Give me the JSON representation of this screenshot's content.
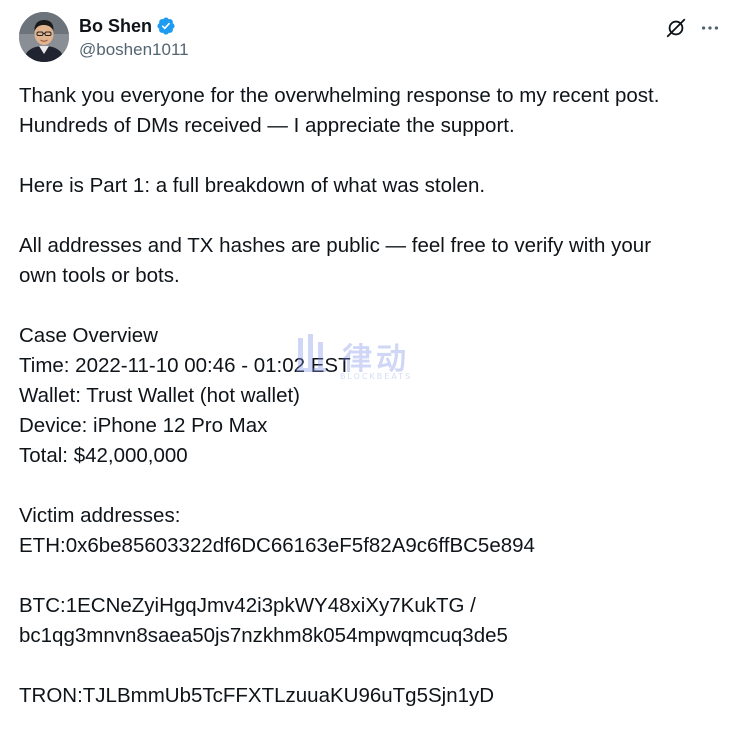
{
  "author": {
    "display_name": "Bo Shen",
    "handle": "@boshen1011",
    "verified": true,
    "verified_color": "#1d9bf0"
  },
  "icons": {
    "verified": "verified-badge-icon",
    "grok": "grok-icon",
    "more": "more-icon"
  },
  "tweet": {
    "paragraphs": [
      {
        "lines": [
          "Thank you everyone for the overwhelming response to my recent post.",
          "Hundreds of DMs received — I appreciate the support."
        ]
      },
      {
        "lines": [
          "Here is Part 1: a full breakdown of what was stolen."
        ]
      },
      {
        "lines": [
          "All addresses and TX hashes are public — feel free to verify with your",
          "own tools or bots."
        ]
      },
      {
        "lines": [
          "Case Overview",
          "Time: 2022-11-10 00:46 - 01:02 EST",
          "Wallet: Trust Wallet (hot wallet)",
          "Device: iPhone 12 Pro Max",
          "Total: $42,000,000"
        ]
      },
      {
        "lines": [
          "Victim addresses:",
          "ETH:0x6be85603322df6DC66163eF5f82A9c6ffBC5e894"
        ]
      },
      {
        "lines": [
          "BTC:1ECNeZyiHgqJmv42i3pkWY48xiXy7KukTG /",
          "bc1qg3mnvn8saea50js7nzkhm8k054mpwqmcuq3de5"
        ]
      },
      {
        "lines": [
          "TRON:TJLBmmUb5TcFFXTLzuuaKU96uTg5Sjn1yD"
        ]
      }
    ]
  },
  "watermark": {
    "text": "律动",
    "subtext": "BLOCKBEATS"
  }
}
